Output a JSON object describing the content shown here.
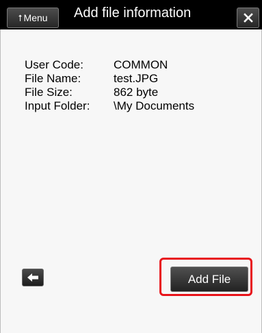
{
  "header": {
    "menu_label": "Menu",
    "menu_icon": "arrow-up-icon",
    "title": "Add file information",
    "close_icon": "close-icon"
  },
  "info": {
    "rows": [
      {
        "label": "User Code:",
        "value": "COMMON"
      },
      {
        "label": "File Name:",
        "value": "test.JPG"
      },
      {
        "label": "File Size:",
        "value": "862 byte"
      },
      {
        "label": "Input Folder:",
        "value": "\\My Documents"
      }
    ]
  },
  "footer": {
    "back_icon": "arrow-left-icon",
    "add_file_label": "Add File",
    "highlight_color": "#e8131a"
  }
}
